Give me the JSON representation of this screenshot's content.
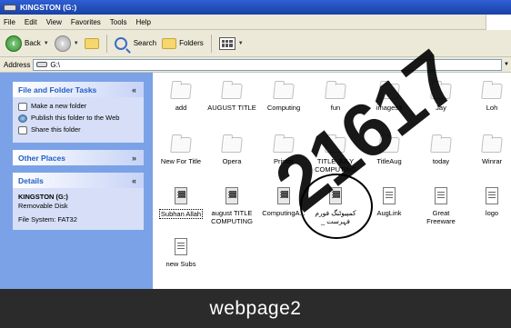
{
  "window": {
    "title": "KINGSTON (G:)"
  },
  "menu": {
    "items": [
      "File",
      "Edit",
      "View",
      "Favorites",
      "Tools",
      "Help"
    ]
  },
  "toolbar": {
    "back_label": "Back",
    "search_label": "Search",
    "folders_label": "Folders"
  },
  "address": {
    "label": "Address",
    "value": "G:\\"
  },
  "sidebar": {
    "file_tasks": {
      "title": "File and Folder Tasks",
      "items": [
        "Make a new folder",
        "Publish this folder to the Web",
        "Share this folder"
      ]
    },
    "other_places": {
      "title": "Other Places"
    },
    "details": {
      "title": "Details",
      "name": "KINGSTON (G:)",
      "type": "Removable Disk",
      "filesystem": "File System: FAT32"
    }
  },
  "files": {
    "row1": [
      "add",
      "AUGUST TITLE",
      "Computing",
      "fun",
      "images3",
      "Jay",
      "Loh"
    ],
    "row2": [
      "New For Title",
      "Opera",
      "Printer",
      "TITLE JULY COMPUTING",
      "TitleAug",
      "today",
      "Winrar"
    ],
    "row3": [
      "Subhan Allah",
      "august TITLE COMPUTING",
      "ComputingA...",
      "کمپیوٹنگ فورم فہرست _",
      "AugLink",
      "Great Freeware",
      "logo"
    ],
    "row4": [
      "new Subs"
    ]
  },
  "banner": {
    "text": "webpage2"
  },
  "watermark": {
    "text": "21617"
  },
  "icons": {
    "folder": "folder-icon",
    "document": "document-icon",
    "back": "back-arrow-icon",
    "forward": "forward-arrow-icon",
    "up": "up-folder-icon",
    "search": "search-icon",
    "folders": "folders-icon",
    "views": "views-icon"
  }
}
